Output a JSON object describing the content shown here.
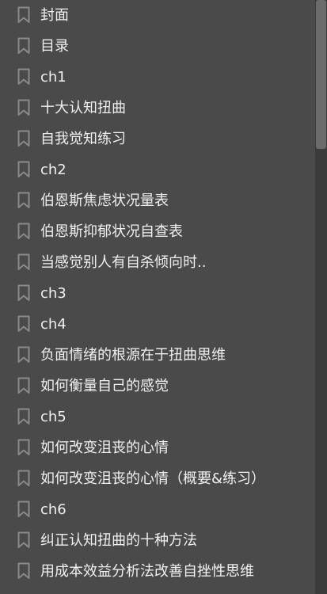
{
  "toc": {
    "items": [
      {
        "label": "封面"
      },
      {
        "label": "目录"
      },
      {
        "label": "ch1"
      },
      {
        "label": "十大认知扭曲"
      },
      {
        "label": "自我觉知练习"
      },
      {
        "label": "ch2"
      },
      {
        "label": "伯恩斯焦虑状况量表"
      },
      {
        "label": "伯恩斯抑郁状况自查表"
      },
      {
        "label": "当感觉别人有自杀倾向时.."
      },
      {
        "label": "ch3"
      },
      {
        "label": "ch4"
      },
      {
        "label": "负面情绪的根源在于扭曲思维"
      },
      {
        "label": "如何衡量自己的感觉"
      },
      {
        "label": "ch5"
      },
      {
        "label": "如何改变沮丧的心情"
      },
      {
        "label": "如何改变沮丧的心情（概要&练习）"
      },
      {
        "label": "ch6"
      },
      {
        "label": "纠正认知扭曲的十种方法"
      },
      {
        "label": "用成本效益分析法改善自挫性思维"
      }
    ]
  },
  "icons": {
    "bookmark": "bookmark-icon"
  },
  "colors": {
    "background": "#4a4a4a",
    "text": "#f0f0f0",
    "icon": "#8a8a8a",
    "scrollbar_track": "#3b3b3b",
    "scrollbar_thumb": "#6b6b6b"
  }
}
